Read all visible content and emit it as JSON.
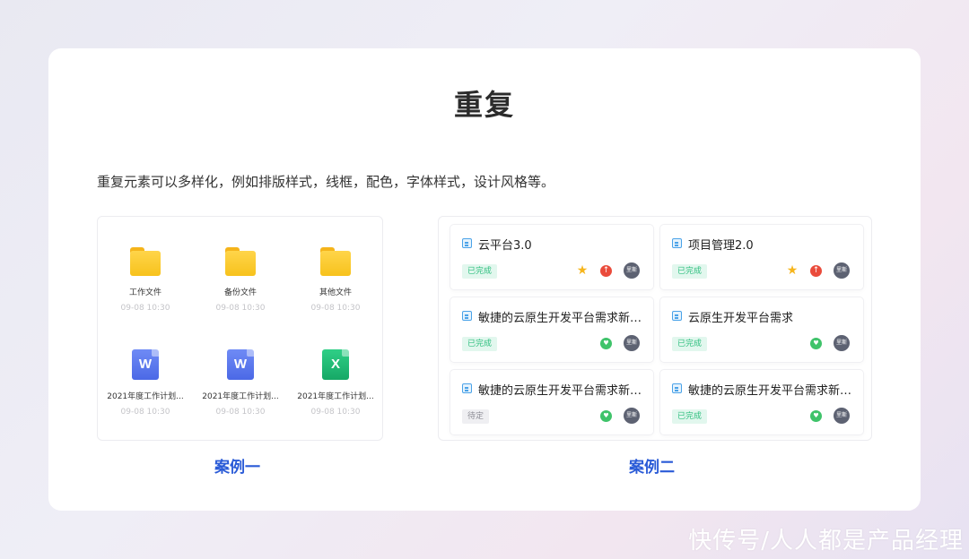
{
  "title": "重复",
  "description": "重复元素可以多样化，例如排版样式，线框，配色，字体样式，设计风格等。",
  "case1": {
    "label": "案例一",
    "files": [
      {
        "type": "folder",
        "name": "工作文件",
        "date": "09-08 10:30"
      },
      {
        "type": "folder",
        "name": "备份文件",
        "date": "09-08 10:30"
      },
      {
        "type": "folder",
        "name": "其他文件",
        "date": "09-08 10:30"
      },
      {
        "type": "word",
        "glyph": "W",
        "name": "2021年度工作计划...",
        "date": "09-08 10:30"
      },
      {
        "type": "word",
        "glyph": "W",
        "name": "2021年度工作计划...",
        "date": "09-08 10:30"
      },
      {
        "type": "excel",
        "glyph": "X",
        "name": "2021年度工作计划...",
        "date": "09-08 10:30"
      }
    ]
  },
  "case2": {
    "label": "案例二",
    "tasks": [
      {
        "title": "云平台3.0",
        "status": "已完成",
        "icons": [
          "star-icon",
          "up-arrow-icon"
        ],
        "avatar": "里斯"
      },
      {
        "title": "项目管理2.0",
        "status": "已完成",
        "icons": [
          "star-icon",
          "up-arrow-icon"
        ],
        "avatar": "里斯"
      },
      {
        "title": "敏捷的云原生开发平台需求新…",
        "status": "已完成",
        "icons": [
          "heart-icon"
        ],
        "avatar": "里斯"
      },
      {
        "title": "云原生开发平台需求",
        "status": "已完成",
        "icons": [
          "heart-icon"
        ],
        "avatar": "里斯"
      },
      {
        "title": "敏捷的云原生开发平台需求新…",
        "status": "待定",
        "icons": [
          "heart-icon"
        ],
        "avatar": "里斯"
      },
      {
        "title": "敏捷的云原生开发平台需求新…",
        "status": "已完成",
        "icons": [
          "heart-icon"
        ],
        "avatar": "里斯"
      }
    ]
  },
  "watermark": "快传号/人人都是产品经理",
  "colors": {
    "accent": "#2a5bd7",
    "done": "#2fbf7f",
    "pending": "#8e8e96"
  }
}
